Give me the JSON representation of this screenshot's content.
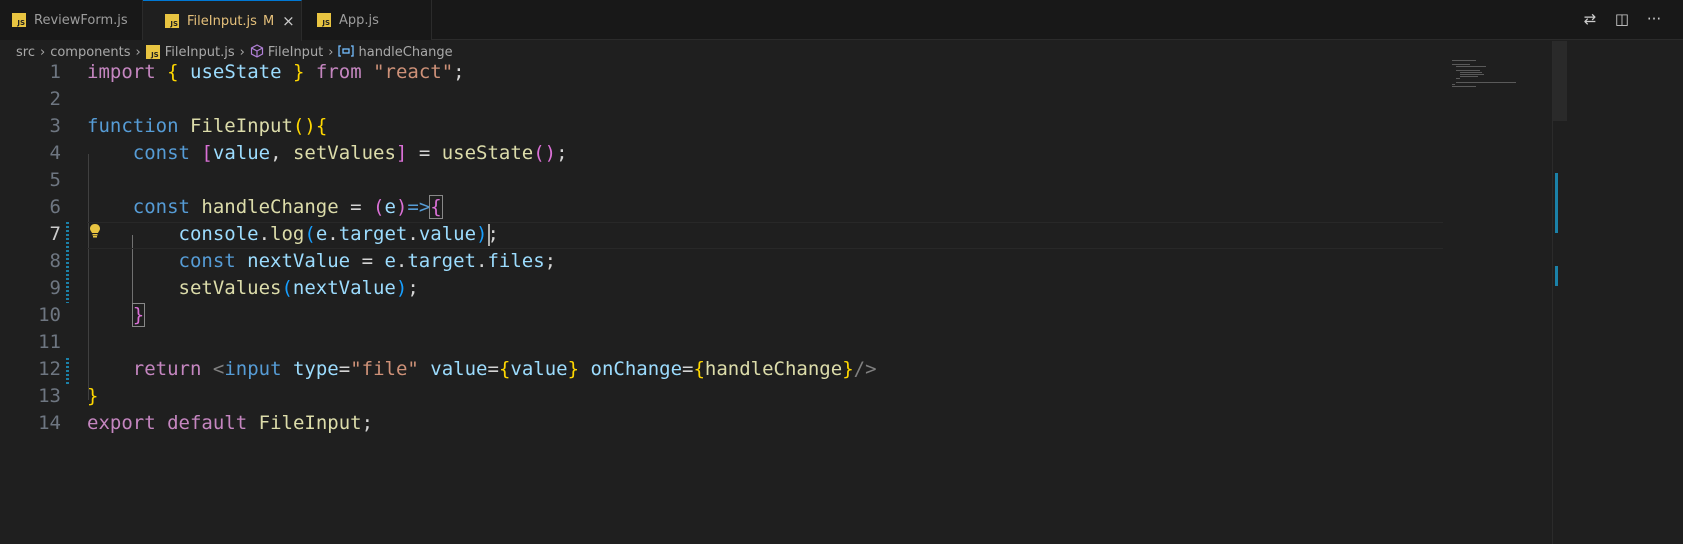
{
  "tabs": [
    {
      "label": "ReviewForm.js",
      "icon": "JS",
      "active": false
    },
    {
      "label": "FileInput.js",
      "icon": "JS",
      "active": true,
      "modified": "M",
      "close": "×"
    },
    {
      "label": "App.js",
      "icon": "JS",
      "active": false
    }
  ],
  "toolbar": {
    "compare_icon": "⇄",
    "split_icon": "◫",
    "more": "···"
  },
  "breadcrumb": {
    "items": [
      "src",
      "components",
      "FileInput.js",
      "FileInput",
      "handleChange"
    ],
    "separator": "›"
  },
  "editor": {
    "current_line": 7,
    "line_numbers": [
      "1",
      "2",
      "3",
      "4",
      "5",
      "6",
      "7",
      "8",
      "9",
      "10",
      "11",
      "12",
      "13",
      "14"
    ]
  },
  "colors": {
    "background": "#1f1f1f",
    "keyword": "#c586c0",
    "storage": "#569cd6",
    "function": "#dcdcaa",
    "variable": "#9cdcfe",
    "string": "#ce9178",
    "accent": "#0078d4"
  }
}
